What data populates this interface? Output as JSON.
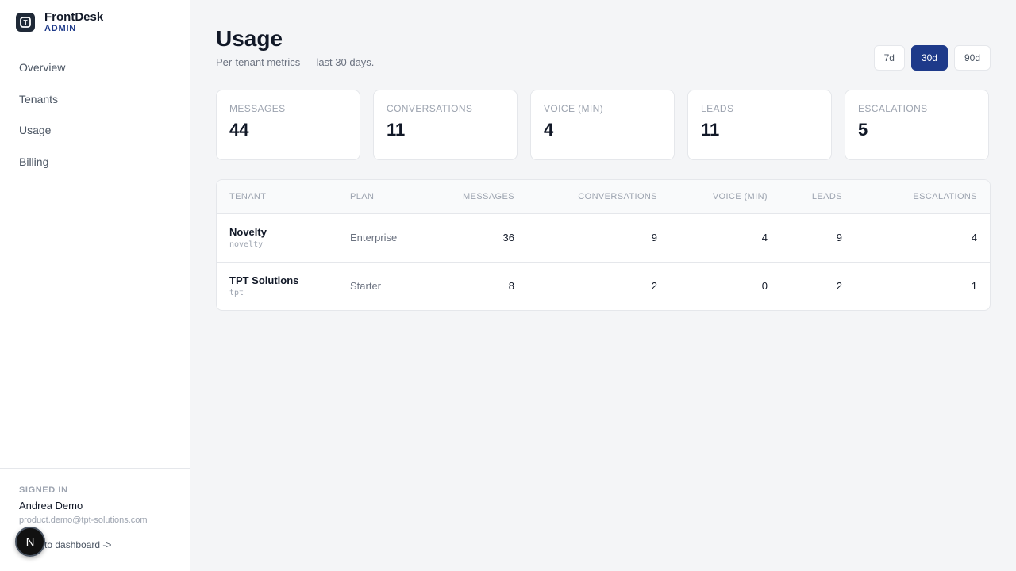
{
  "brand": {
    "name": "FrontDesk",
    "sub": "ADMIN"
  },
  "nav": [
    {
      "label": "Overview"
    },
    {
      "label": "Tenants"
    },
    {
      "label": "Usage"
    },
    {
      "label": "Billing"
    }
  ],
  "footer": {
    "signed_in_label": "SIGNED IN",
    "user_name": "Andrea Demo",
    "user_email": "product.demo@tpt-solutions.com",
    "back_link": "to dashboard ->",
    "badge": "N"
  },
  "page": {
    "title": "Usage",
    "subtitle": "Per-tenant metrics — last 30 days."
  },
  "ranges": [
    {
      "label": "7d",
      "active": false
    },
    {
      "label": "30d",
      "active": true
    },
    {
      "label": "90d",
      "active": false
    }
  ],
  "stats": [
    {
      "label": "MESSAGES",
      "value": "44"
    },
    {
      "label": "CONVERSATIONS",
      "value": "11"
    },
    {
      "label": "VOICE (MIN)",
      "value": "4"
    },
    {
      "label": "LEADS",
      "value": "11"
    },
    {
      "label": "ESCALATIONS",
      "value": "5"
    }
  ],
  "table": {
    "headers": [
      "TENANT",
      "PLAN",
      "MESSAGES",
      "CONVERSATIONS",
      "VOICE (MIN)",
      "LEADS",
      "ESCALATIONS"
    ],
    "rows": [
      {
        "name": "Novelty",
        "slug": "novelty",
        "plan": "Enterprise",
        "messages": "36",
        "conversations": "9",
        "voice": "4",
        "leads": "9",
        "escalations": "4"
      },
      {
        "name": "TPT Solutions",
        "slug": "tpt",
        "plan": "Starter",
        "messages": "8",
        "conversations": "2",
        "voice": "0",
        "leads": "2",
        "escalations": "1"
      }
    ]
  },
  "colors": {
    "accent": "#1e3a8a",
    "background": "#f4f5f7"
  }
}
